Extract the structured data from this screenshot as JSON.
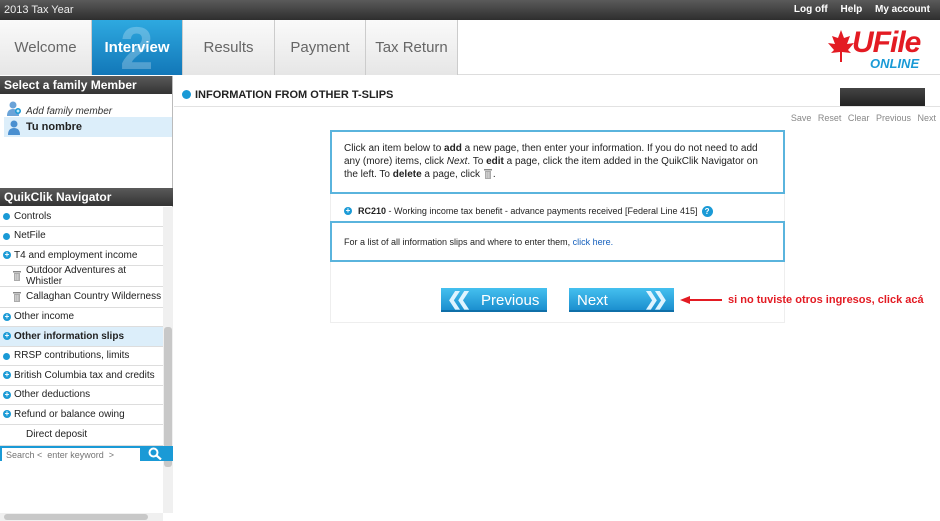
{
  "topbar": {
    "year": "2013 Tax Year",
    "links": [
      "Log off",
      "Help",
      "My account"
    ]
  },
  "tabs": [
    {
      "label": "Welcome"
    },
    {
      "label": "Interview",
      "number": "2",
      "active": true
    },
    {
      "label": "Results"
    },
    {
      "label": "Payment"
    },
    {
      "label": "Tax Return"
    }
  ],
  "logo": {
    "brand": "UFile",
    "sub": "ONLINE"
  },
  "family": {
    "header": "Select a family Member",
    "add_member": "Add family member",
    "current": "Tu nombre"
  },
  "navigator": {
    "header": "QuikClik Navigator",
    "items": [
      {
        "label": "Controls"
      },
      {
        "label": "NetFile"
      },
      {
        "label": "T4 and employment income"
      },
      {
        "label": "Outdoor Adventures at Whistler"
      },
      {
        "label": "Callaghan Country Wilderness Adv"
      },
      {
        "label": "Other income"
      },
      {
        "label": "Other information slips"
      },
      {
        "label": "RRSP contributions, limits"
      },
      {
        "label": "British Columbia tax and credits"
      },
      {
        "label": "Other deductions"
      },
      {
        "label": "Refund or balance owing"
      },
      {
        "label": "Direct deposit"
      }
    ]
  },
  "search": {
    "placeholder": "Search <  enter keyword  >"
  },
  "page": {
    "title": "INFORMATION FROM OTHER T-SLIPS",
    "actions": [
      "Save",
      "Reset",
      "Clear",
      "Previous",
      "Next"
    ],
    "instructions": {
      "t1": "Click an item below to ",
      "add": "add",
      "t2": " a new page, then enter your information. If you do not need to add any (more) items, click ",
      "next": "Next",
      "t3": ". To ",
      "edit": "edit",
      "t4": " a page, click the item added in the QuikClik Navigator on the left. To ",
      "delete": "delete",
      "t5": " a page, click ",
      "t6": "."
    },
    "rc210": {
      "code": "RC210",
      "text": " - Working income tax benefit - advance payments received [Federal Line 415]"
    },
    "slips": {
      "text": "For a list of all information slips and where to enter them, ",
      "link": "click here."
    },
    "prev_button": "Previous",
    "next_button": "Next",
    "annotation": "si no tuviste otros ingresos, click acá"
  },
  "colors": {
    "accent": "#1a9ad6",
    "annotation": "#e31b23",
    "brand_red": "#e31b23"
  }
}
